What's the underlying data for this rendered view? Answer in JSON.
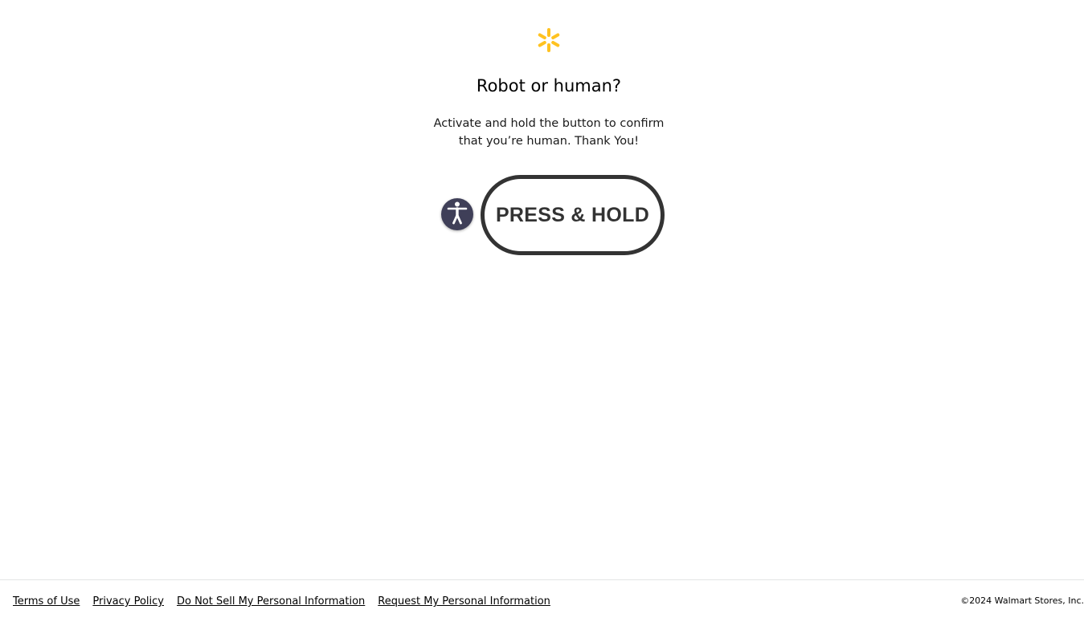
{
  "header": {
    "logo_icon": "walmart-spark-icon",
    "logo_color": "#ffc220"
  },
  "main": {
    "title": "Robot or human?",
    "subtitle": "Activate and hold the button to confirm that you’re human. Thank You!",
    "accessibility_icon": "accessibility-icon",
    "press_hold_label": "PRESS & HOLD"
  },
  "footer": {
    "links": [
      {
        "label": "Terms of Use "
      },
      {
        "label": "Privacy Policy "
      },
      {
        "label": "Do Not Sell My Personal Information "
      },
      {
        "label": "Request My Personal Information"
      }
    ],
    "copyright": "©2024 Walmart Stores, Inc."
  },
  "colors": {
    "accent": "#ffc220",
    "button_border": "#333333",
    "accessibility_bg": "#3f3f58"
  }
}
